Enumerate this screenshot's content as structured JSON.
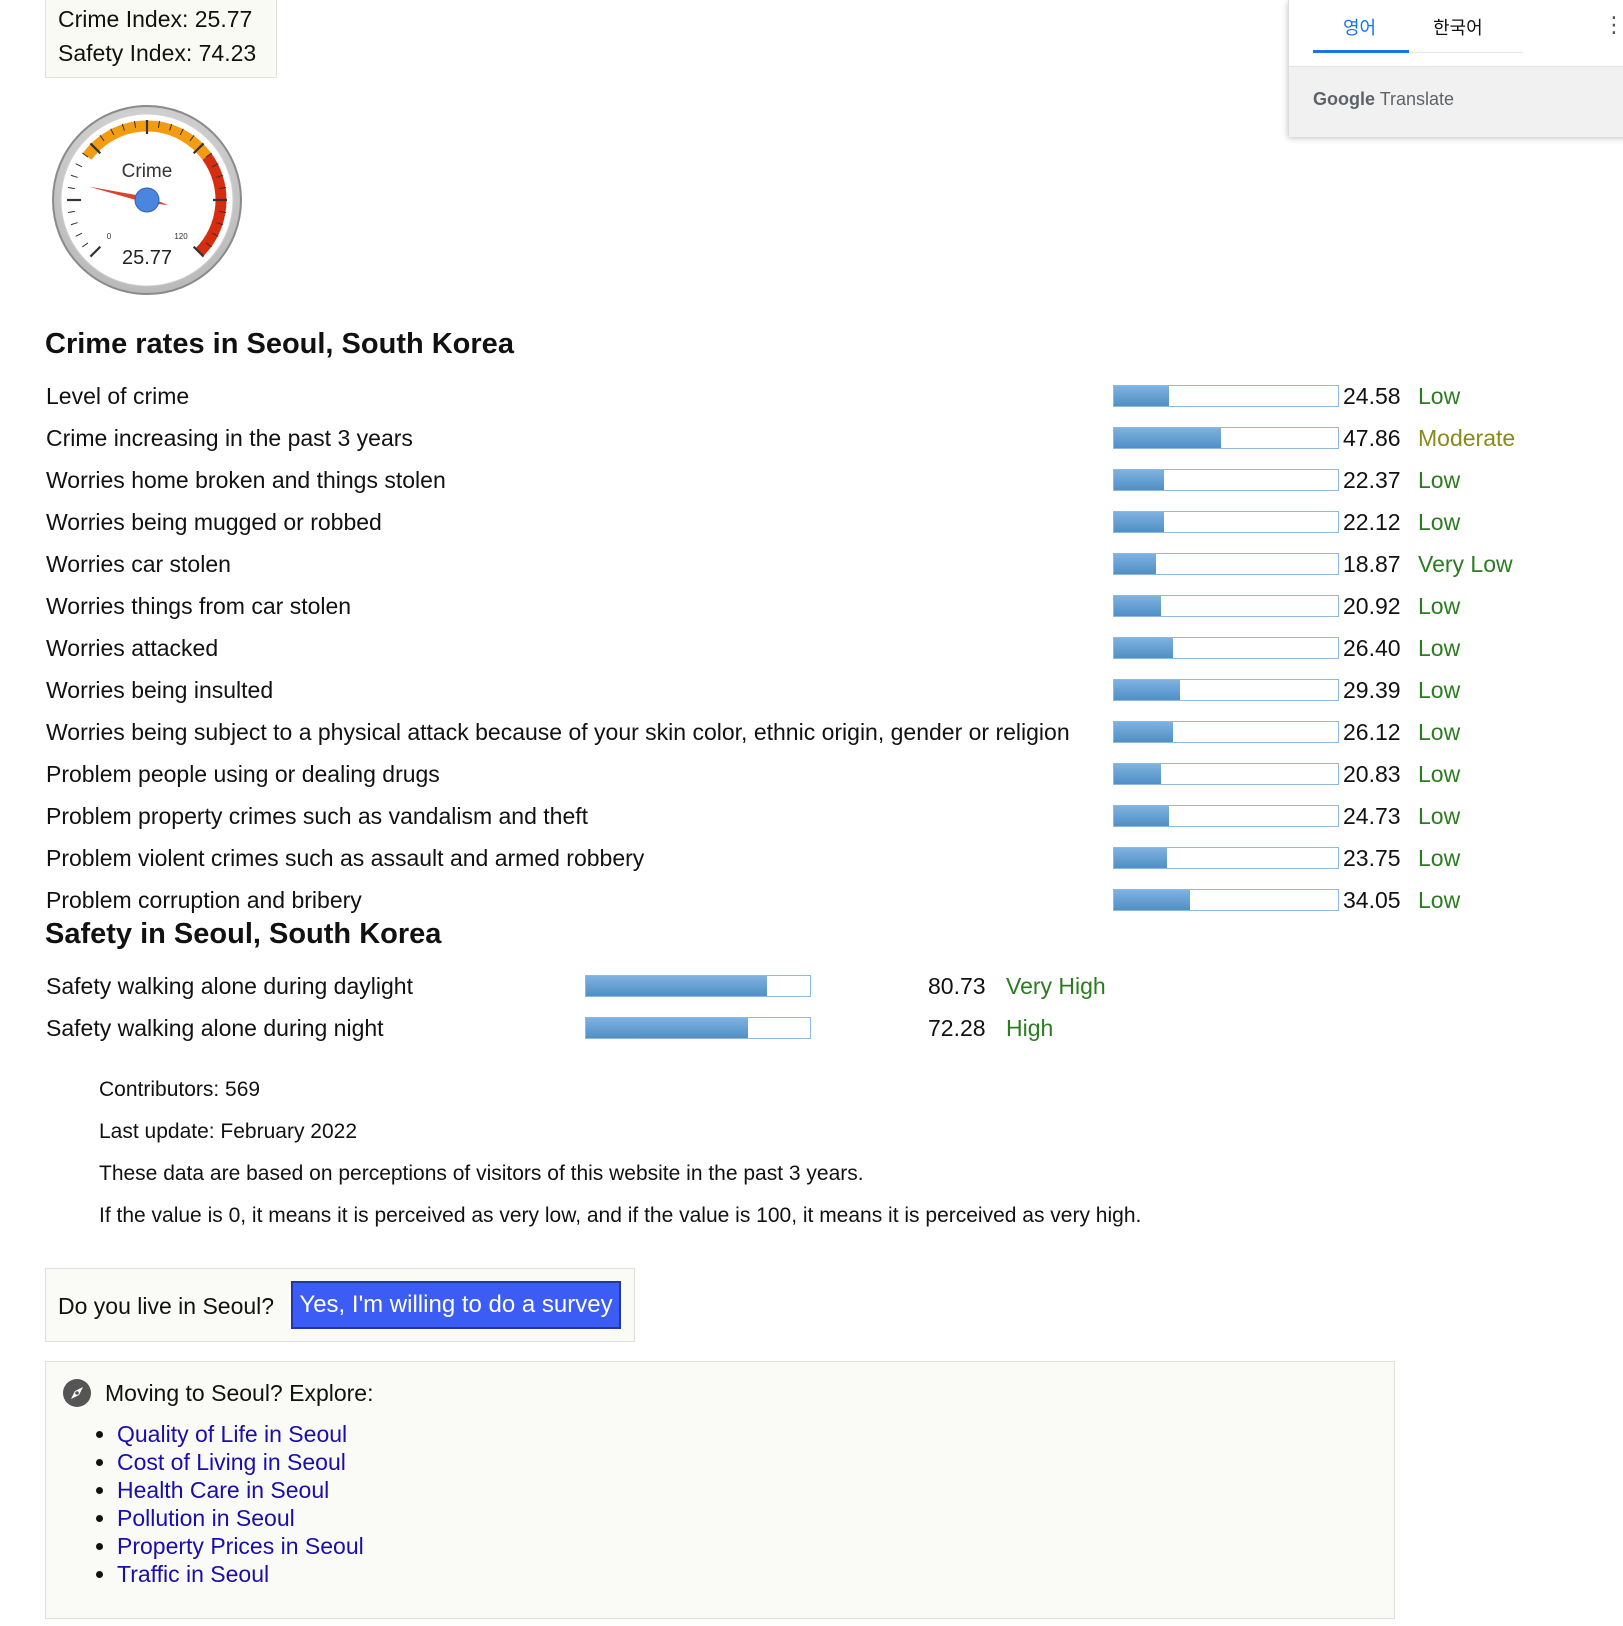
{
  "index_box": {
    "crime_label": "Crime Index:",
    "crime_value": "25.77",
    "safety_label": "Safety Index:",
    "safety_value": "74.23"
  },
  "gauge": {
    "label": "Crime",
    "value_text": "25.77",
    "value": 25.77,
    "min_label": "0",
    "max_label": "120",
    "min": 0,
    "max": 120
  },
  "crime_section": {
    "heading": "Crime rates in Seoul, South Korea",
    "rows": [
      {
        "label": "Level of crime",
        "value": "24.58",
        "level": "Low",
        "level_color": "green"
      },
      {
        "label": "Crime increasing in the past 3 years",
        "value": "47.86",
        "level": "Moderate",
        "level_color": "olive"
      },
      {
        "label": "Worries home broken and things stolen",
        "value": "22.37",
        "level": "Low",
        "level_color": "green"
      },
      {
        "label": "Worries being mugged or robbed",
        "value": "22.12",
        "level": "Low",
        "level_color": "green"
      },
      {
        "label": "Worries car stolen",
        "value": "18.87",
        "level": "Very Low",
        "level_color": "green"
      },
      {
        "label": "Worries things from car stolen",
        "value": "20.92",
        "level": "Low",
        "level_color": "green"
      },
      {
        "label": "Worries attacked",
        "value": "26.40",
        "level": "Low",
        "level_color": "green"
      },
      {
        "label": "Worries being insulted",
        "value": "29.39",
        "level": "Low",
        "level_color": "green"
      },
      {
        "label": "Worries being subject to a physical attack because of your skin color, ethnic origin, gender or religion",
        "value": "26.12",
        "level": "Low",
        "level_color": "green"
      },
      {
        "label": "Problem people using or dealing drugs",
        "value": "20.83",
        "level": "Low",
        "level_color": "green"
      },
      {
        "label": "Problem property crimes such as vandalism and theft",
        "value": "24.73",
        "level": "Low",
        "level_color": "green"
      },
      {
        "label": "Problem violent crimes such as assault and armed robbery",
        "value": "23.75",
        "level": "Low",
        "level_color": "green"
      },
      {
        "label": "Problem corruption and bribery",
        "value": "34.05",
        "level": "Low",
        "level_color": "green"
      }
    ]
  },
  "safety_section": {
    "heading": "Safety in Seoul, South Korea",
    "rows": [
      {
        "label": "Safety walking alone during daylight",
        "value": "80.73",
        "level": "Very High",
        "level_color": "green"
      },
      {
        "label": "Safety walking alone during night",
        "value": "72.28",
        "level": "High",
        "level_color": "green"
      }
    ]
  },
  "info": {
    "contributors": "Contributors: 569",
    "last_update": "Last update: February 2022",
    "note1": "These data are based on perceptions of visitors of this website in the past 3 years.",
    "note2": "If the value is 0, it means it is perceived as very low, and if the value is 100, it means it is perceived as very high."
  },
  "survey": {
    "question": "Do you live in Seoul?",
    "button": "Yes, I'm willing to do a survey"
  },
  "explore": {
    "icon": "compass-icon",
    "title": "Moving to Seoul? Explore:",
    "links": [
      "Quality of Life in Seoul",
      "Cost of Living in Seoul",
      "Health Care in Seoul",
      "Pollution in Seoul",
      "Property Prices in Seoul",
      "Traffic in Seoul"
    ]
  },
  "translate_popup": {
    "tab_english": "영어",
    "tab_korean": "한국어",
    "brand_google": "Google",
    "brand_translate": "Translate"
  },
  "colors": {
    "bar_fill": "#5b9bd5",
    "level_green": "#2a7d1f",
    "level_olive": "#8a8a1a",
    "button_blue": "#3b5cf5",
    "link_blue": "#1a0dab"
  }
}
